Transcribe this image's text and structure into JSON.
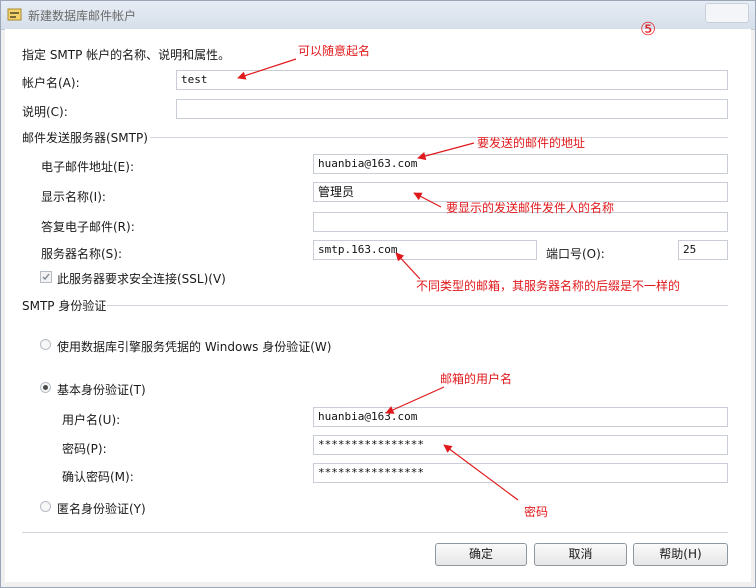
{
  "window": {
    "title": "新建数据库邮件帐户"
  },
  "intro": "指定 SMTP 帐户的名称、说明和属性。",
  "account": {
    "name_label": "帐户名(A):",
    "name_value": "test",
    "desc_label": "说明(C):",
    "desc_value": ""
  },
  "smtp_server": {
    "group_title": "邮件发送服务器(SMTP)",
    "email_label": "电子邮件地址(E):",
    "email_value": "huanbia@163.com",
    "display_label": "显示名称(I):",
    "display_value": "管理员",
    "reply_label": "答复电子邮件(R):",
    "reply_value": "",
    "server_label": "服务器名称(S):",
    "server_value": "smtp.163.com",
    "port_label": "端口号(O):",
    "port_value": "25",
    "ssl_label": "此服务器要求安全连接(SSL)(V)"
  },
  "auth": {
    "group_title": "SMTP 身份验证",
    "windows_label": "使用数据库引擎服务凭据的 Windows 身份验证(W)",
    "basic_label": "基本身份验证(T)",
    "user_label": "用户名(U):",
    "user_value": "huanbia@163.com",
    "pwd_label": "密码(P):",
    "pwd_value": "****************",
    "confirm_label": "确认密码(M):",
    "confirm_value": "****************",
    "anon_label": "匿名身份验证(Y)"
  },
  "buttons": {
    "ok": "确定",
    "cancel": "取消",
    "help": "帮助(H)"
  },
  "annotations": {
    "step": "⑤",
    "any_name": "可以随意起名",
    "email_addr": "要发送的邮件的地址",
    "display_name": "要显示的发送邮件发件人的名称",
    "server_suffix": "不同类型的邮箱，其服务器名称的后缀是不一样的",
    "mail_user": "邮箱的用户名",
    "password": "密码"
  },
  "colors": {
    "annotation": "#e0191c"
  }
}
